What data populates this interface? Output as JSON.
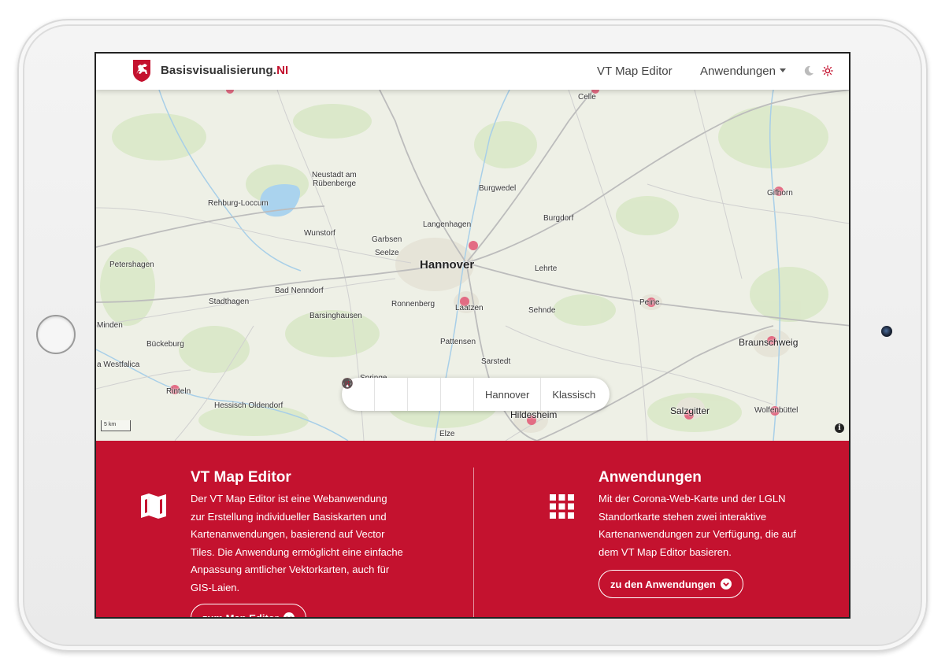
{
  "navbar": {
    "brand_main": "Basisvisualisierung.",
    "brand_accent": "NI",
    "link_editor": "VT Map Editor",
    "link_apps": "Anwendungen",
    "accent_color": "#c4122f"
  },
  "map": {
    "labels": {
      "hannover": "Hannover",
      "celle": "Celle",
      "neustadt1": "Neustadt am",
      "neustadt2": "Rübenberge",
      "burgwedel": "Burgwedel",
      "gifhorn": "Gifhorn",
      "rehburg": "Rehburg-Loccum",
      "langenhagen": "Langenhagen",
      "burgdorf": "Burgdorf",
      "wunstorf": "Wunstorf",
      "garbsen": "Garbsen",
      "seelze": "Seelze",
      "petershagen": "Petershagen",
      "lehrte": "Lehrte",
      "stadthagen": "Stadthagen",
      "badnenndorf": "Bad Nenndorf",
      "ronnenberg": "Ronnenberg",
      "laatzen": "Laatzen",
      "peine": "Peine",
      "minden": "Minden",
      "barsinghausen": "Barsinghausen",
      "sehnde": "Sehnde",
      "braunschweig": "Braunschweig",
      "bueckeburg": "Bückeburg",
      "pattensen": "Pattensen",
      "westfalica": "a Westfalica",
      "sarstedt": "Sarstedt",
      "rinteln": "Rinteln",
      "hessisch": "Hessisch Oldendorf",
      "hildesheim": "Hildesheim",
      "salzgitter": "Salzgitter",
      "wolfenbuettel": "Wolfenbüttel",
      "springe": "Springe",
      "elze": "Elze"
    },
    "scale": "5 km",
    "info": "i",
    "controls": {
      "home_icon": "home-icon",
      "pin_icon": "pin-icon",
      "pause_icon": "pause-icon",
      "play_icon": "play-icon",
      "location": "Hannover",
      "style": "Klassisch"
    }
  },
  "features": {
    "editor": {
      "icon": "map-icon",
      "title": "VT Map Editor",
      "text": "Der VT Map Editor ist eine Webanwendung zur Erstellung individueller Basiskarten und Kartenanwendungen, basierend auf Vector Tiles. Die Anwendung ermöglicht eine einfache Anpassung amtlicher Vektorkarten, auch für GIS-Laien.",
      "button": "zum Map Editor"
    },
    "apps": {
      "icon": "grid-icon",
      "title": "Anwendungen",
      "text": "Mit der Corona-Web-Karte und der LGLN Standortkarte stehen zwei interaktive Kartenanwendungen zur Verfügung, die auf dem VT Map Editor basieren.",
      "button": "zu den Anwendungen"
    }
  }
}
